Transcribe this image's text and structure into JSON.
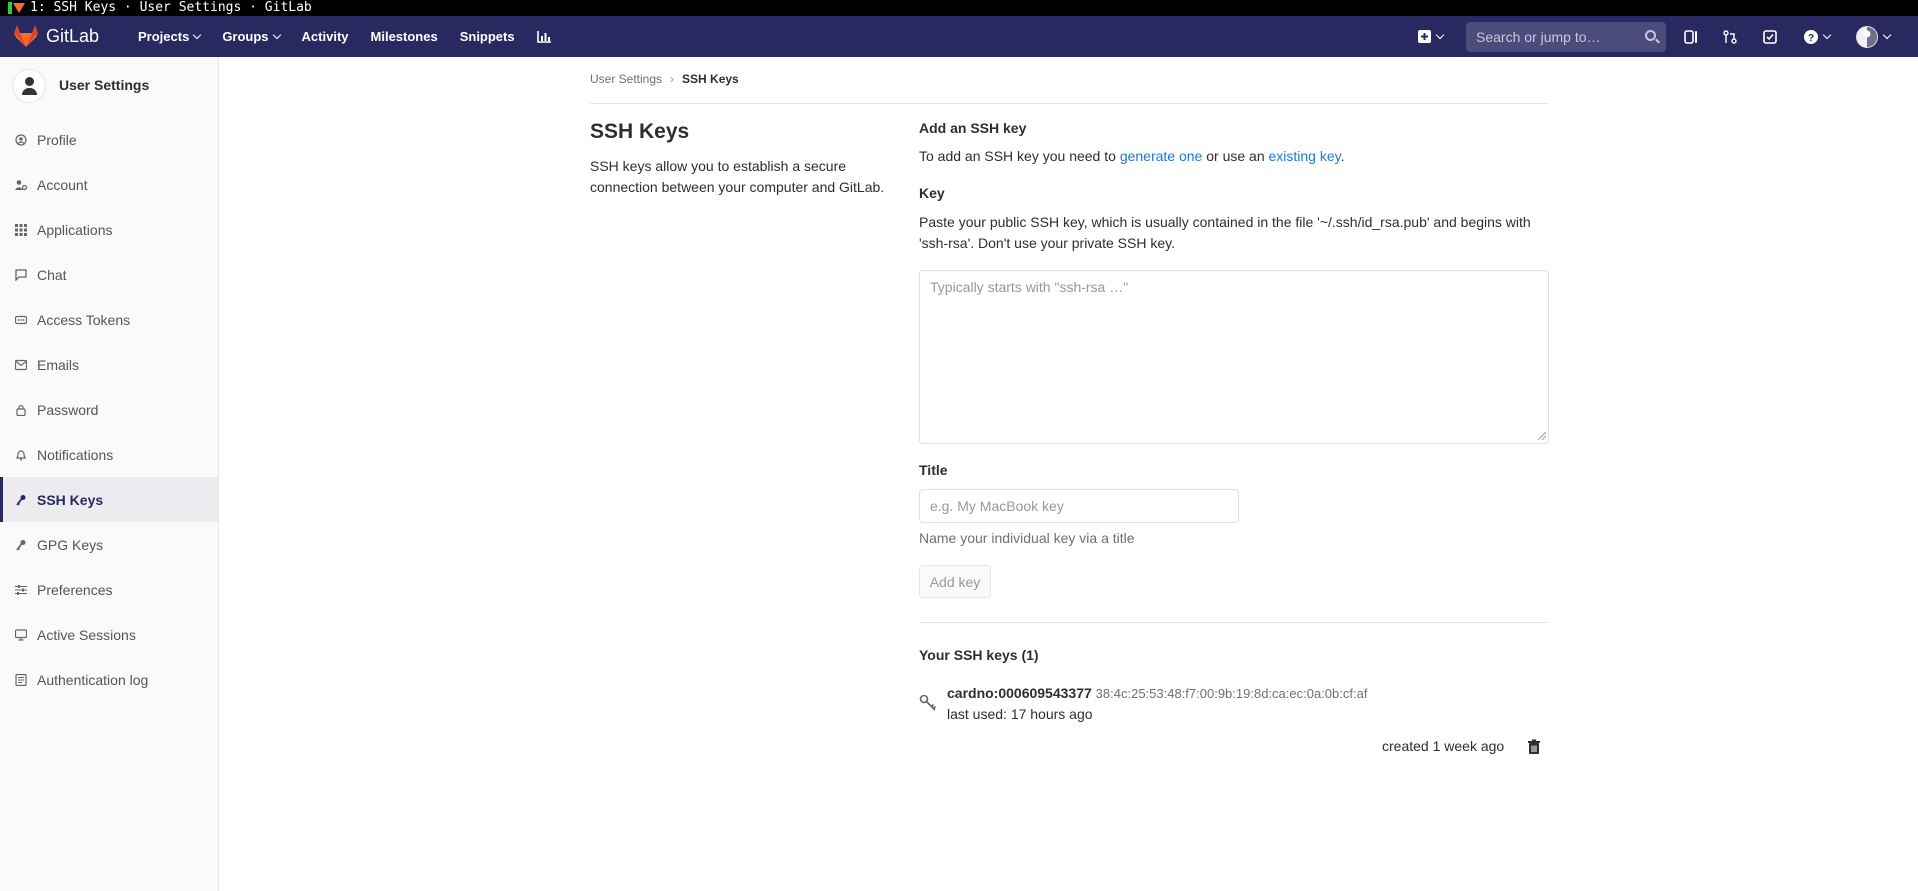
{
  "window": {
    "title": "1: SSH Keys · User Settings · GitLab"
  },
  "navbar": {
    "brand": "GitLab",
    "links": [
      {
        "label": "Projects",
        "dropdown": true
      },
      {
        "label": "Groups",
        "dropdown": true
      },
      {
        "label": "Activity",
        "dropdown": false
      },
      {
        "label": "Milestones",
        "dropdown": false
      },
      {
        "label": "Snippets",
        "dropdown": false
      }
    ],
    "search_placeholder": "Search or jump to…",
    "colors": {
      "bg": "#292961",
      "accent": "#fc6d26"
    }
  },
  "sidebar": {
    "title": "User Settings",
    "items": [
      {
        "label": "Profile",
        "icon": "profile-icon"
      },
      {
        "label": "Account",
        "icon": "account-icon"
      },
      {
        "label": "Applications",
        "icon": "applications-icon"
      },
      {
        "label": "Chat",
        "icon": "chat-icon"
      },
      {
        "label": "Access Tokens",
        "icon": "token-icon"
      },
      {
        "label": "Emails",
        "icon": "mail-icon"
      },
      {
        "label": "Password",
        "icon": "lock-icon"
      },
      {
        "label": "Notifications",
        "icon": "bell-icon"
      },
      {
        "label": "SSH Keys",
        "icon": "key-icon",
        "active": true
      },
      {
        "label": "GPG Keys",
        "icon": "key-icon"
      },
      {
        "label": "Preferences",
        "icon": "sliders-icon"
      },
      {
        "label": "Active Sessions",
        "icon": "monitor-icon"
      },
      {
        "label": "Authentication log",
        "icon": "log-icon"
      }
    ]
  },
  "breadcrumb": {
    "parent": "User Settings",
    "current": "SSH Keys"
  },
  "page": {
    "title": "SSH Keys",
    "description": "SSH keys allow you to establish a secure connection between your computer and GitLab."
  },
  "add_form": {
    "heading": "Add an SSH key",
    "intro_prefix": "To add an SSH key you need to ",
    "intro_link1": "generate one",
    "intro_middle": " or use an ",
    "intro_link2": "existing key",
    "intro_suffix": ".",
    "key_label": "Key",
    "key_help": "Paste your public SSH key, which is usually contained in the file '~/.ssh/id_rsa.pub' and begins with 'ssh-rsa'. Don't use your private SSH key.",
    "key_placeholder": "Typically starts with \"ssh-rsa …\"",
    "key_value": "",
    "title_label": "Title",
    "title_placeholder": "e.g. My MacBook key",
    "title_value": "",
    "title_help": "Name your individual key via a title",
    "submit_label": "Add key"
  },
  "keys_list": {
    "heading": "Your SSH keys (1)",
    "keys": [
      {
        "name": "cardno:000609543377",
        "fingerprint": "38:4c:25:53:48:f7:00:9b:19:8d:ca:ec:0a:0b:cf:af",
        "last_used": "last used: 17 hours ago",
        "created": "created 1 week ago"
      }
    ]
  }
}
